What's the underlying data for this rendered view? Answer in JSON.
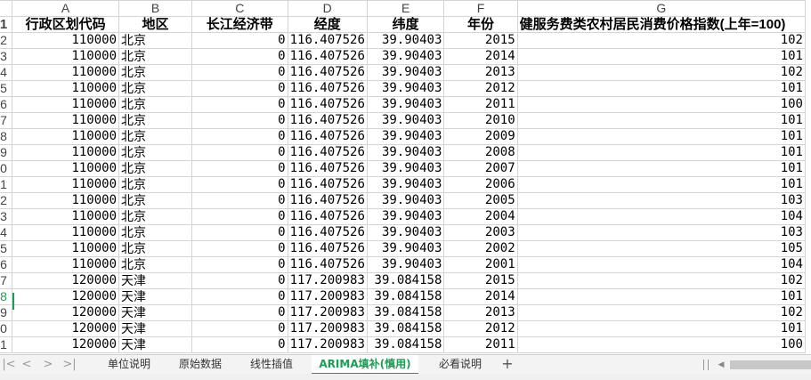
{
  "columns": [
    "A",
    "B",
    "C",
    "D",
    "E",
    "F",
    "G"
  ],
  "header": [
    "行政区划代码",
    "地区",
    "长江经济带",
    "经度",
    "纬度",
    "年份",
    "健服务费类农村居民消费价格指数(上年=100)"
  ],
  "row_numbers": [
    "1",
    "2",
    "3",
    "4",
    "5",
    "6",
    "7",
    "8",
    "9",
    "0",
    "1",
    "2",
    "3",
    "4",
    "5",
    "6",
    "7",
    "8",
    "9",
    "0",
    "1"
  ],
  "rows": [
    [
      "110000",
      "北京",
      "0",
      "116.407526",
      "39.90403",
      "2015",
      "102"
    ],
    [
      "110000",
      "北京",
      "0",
      "116.407526",
      "39.90403",
      "2014",
      "101"
    ],
    [
      "110000",
      "北京",
      "0",
      "116.407526",
      "39.90403",
      "2013",
      "102"
    ],
    [
      "110000",
      "北京",
      "0",
      "116.407526",
      "39.90403",
      "2012",
      "101"
    ],
    [
      "110000",
      "北京",
      "0",
      "116.407526",
      "39.90403",
      "2011",
      "100"
    ],
    [
      "110000",
      "北京",
      "0",
      "116.407526",
      "39.90403",
      "2010",
      "101"
    ],
    [
      "110000",
      "北京",
      "0",
      "116.407526",
      "39.90403",
      "2009",
      "101"
    ],
    [
      "110000",
      "北京",
      "0",
      "116.407526",
      "39.90403",
      "2008",
      "101"
    ],
    [
      "110000",
      "北京",
      "0",
      "116.407526",
      "39.90403",
      "2007",
      "101"
    ],
    [
      "110000",
      "北京",
      "0",
      "116.407526",
      "39.90403",
      "2006",
      "101"
    ],
    [
      "110000",
      "北京",
      "0",
      "116.407526",
      "39.90403",
      "2005",
      "103"
    ],
    [
      "110000",
      "北京",
      "0",
      "116.407526",
      "39.90403",
      "2004",
      "104"
    ],
    [
      "110000",
      "北京",
      "0",
      "116.407526",
      "39.90403",
      "2003",
      "103"
    ],
    [
      "110000",
      "北京",
      "0",
      "116.407526",
      "39.90403",
      "2002",
      "105"
    ],
    [
      "110000",
      "北京",
      "0",
      "116.407526",
      "39.90403",
      "2001",
      "104"
    ],
    [
      "120000",
      "天津",
      "0",
      "117.200983",
      "39.084158",
      "2015",
      "102"
    ],
    [
      "120000",
      "天津",
      "0",
      "117.200983",
      "39.084158",
      "2014",
      "101"
    ],
    [
      "120000",
      "天津",
      "0",
      "117.200983",
      "39.084158",
      "2013",
      "102"
    ],
    [
      "120000",
      "天津",
      "0",
      "117.200983",
      "39.084158",
      "2012",
      "101"
    ],
    [
      "120000",
      "天津",
      "0",
      "117.200983",
      "39.084158",
      "2011",
      "100"
    ]
  ],
  "tabs": [
    "单位说明",
    "原始数据",
    "线性插值",
    "ARIMA填补(慎用)",
    "必看说明"
  ],
  "active_tab_index": 3,
  "selected_row_number": "8",
  "icons": {
    "first": "first-sheet-icon",
    "prev": "prev-sheet-icon",
    "next": "next-sheet-icon",
    "last": "last-sheet-icon",
    "add": "add-sheet-icon"
  },
  "colors": {
    "accent": "#1e9b54",
    "grid": "#d4d4d4"
  }
}
